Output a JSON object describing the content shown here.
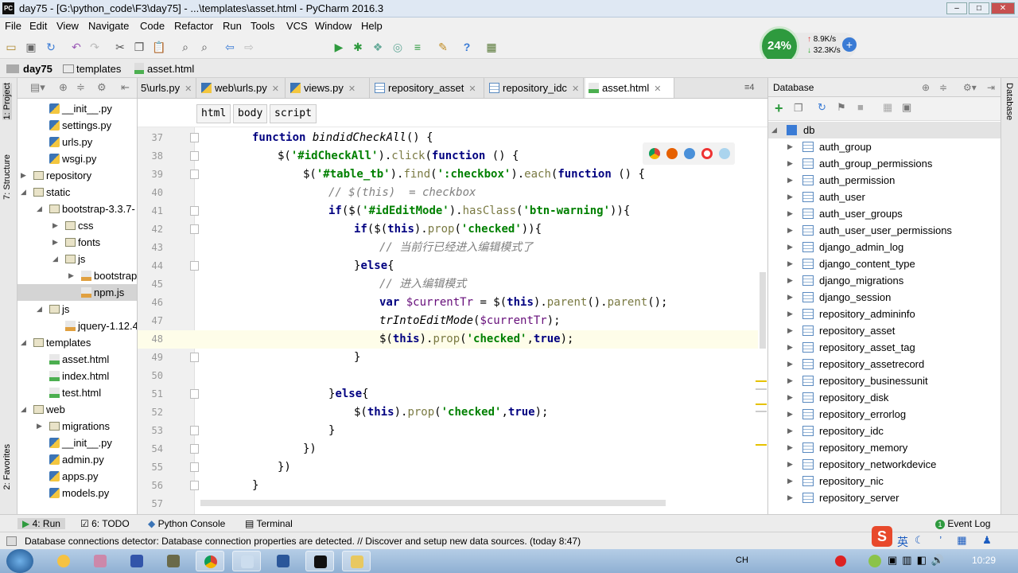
{
  "window": {
    "title": "day75 - [G:\\python_code\\F3\\day75] - ...\\templates\\asset.html - PyCharm 2016.3",
    "logo": "PC"
  },
  "menu": [
    "File",
    "Edit",
    "View",
    "Navigate",
    "Code",
    "Refactor",
    "Run",
    "Tools",
    "VCS",
    "Window",
    "Help"
  ],
  "toolbar": {
    "run_config": "day75",
    "run_config_icon": "dj"
  },
  "net_widget": {
    "cpu": "24%",
    "up": "8.9K/s",
    "down": "32.3K/s"
  },
  "breadcrumb": [
    "day75",
    "templates",
    "asset.html"
  ],
  "left_strip": {
    "project": "1: Project",
    "structure": "7: Structure",
    "favorites": "2: Favorites"
  },
  "project_tree": [
    {
      "label": "__init__.py",
      "depth": 2,
      "icon": "py"
    },
    {
      "label": "settings.py",
      "depth": 2,
      "icon": "py"
    },
    {
      "label": "urls.py",
      "depth": 2,
      "icon": "py"
    },
    {
      "label": "wsgi.py",
      "depth": 2,
      "icon": "py"
    },
    {
      "label": "repository",
      "depth": 1,
      "icon": "folder",
      "arrow": "closed"
    },
    {
      "label": "static",
      "depth": 1,
      "icon": "folder",
      "arrow": "open"
    },
    {
      "label": "bootstrap-3.3.7-",
      "depth": 2,
      "icon": "folder",
      "arrow": "open"
    },
    {
      "label": "css",
      "depth": 3,
      "icon": "folder",
      "arrow": "closed"
    },
    {
      "label": "fonts",
      "depth": 3,
      "icon": "folder",
      "arrow": "closed"
    },
    {
      "label": "js",
      "depth": 3,
      "icon": "folder",
      "arrow": "open"
    },
    {
      "label": "bootstrap",
      "depth": 4,
      "icon": "js",
      "arrow": "closed"
    },
    {
      "label": "npm.js",
      "depth": 4,
      "icon": "js",
      "selected": true
    },
    {
      "label": "js",
      "depth": 2,
      "icon": "folder",
      "arrow": "open"
    },
    {
      "label": "jquery-1.12.4",
      "depth": 3,
      "icon": "js"
    },
    {
      "label": "templates",
      "depth": 1,
      "icon": "folder",
      "arrow": "open"
    },
    {
      "label": "asset.html",
      "depth": 2,
      "icon": "html"
    },
    {
      "label": "index.html",
      "depth": 2,
      "icon": "html"
    },
    {
      "label": "test.html",
      "depth": 2,
      "icon": "html"
    },
    {
      "label": "web",
      "depth": 1,
      "icon": "folder",
      "arrow": "open"
    },
    {
      "label": "migrations",
      "depth": 2,
      "icon": "folder",
      "arrow": "closed"
    },
    {
      "label": "__init__.py",
      "depth": 2,
      "icon": "py"
    },
    {
      "label": "admin.py",
      "depth": 2,
      "icon": "py"
    },
    {
      "label": "apps.py",
      "depth": 2,
      "icon": "py"
    },
    {
      "label": "models.py",
      "depth": 2,
      "icon": "py"
    }
  ],
  "editor_tabs": [
    {
      "label": "5\\urls.py",
      "icon": "py"
    },
    {
      "label": "web\\urls.py",
      "icon": "py"
    },
    {
      "label": "views.py",
      "icon": "py"
    },
    {
      "label": "repository_asset",
      "icon": "tbl"
    },
    {
      "label": "repository_idc",
      "icon": "tbl"
    },
    {
      "label": "asset.html",
      "icon": "html",
      "active": true
    }
  ],
  "tab_overflow": "4",
  "tag_breadcrumb": [
    "html",
    "body",
    "script"
  ],
  "code_lines": [
    {
      "n": "37",
      "indent": 2,
      "fold": true,
      "tokens": [
        [
          "k",
          "function "
        ],
        [
          "fn",
          "bindidCheckAll"
        ],
        [
          "p",
          "() {"
        ]
      ]
    },
    {
      "n": "38",
      "indent": 3,
      "fold": true,
      "tokens": [
        [
          "p",
          "$("
        ],
        [
          "s",
          "'#idCheckAll'"
        ],
        [
          "p",
          ")."
        ],
        [
          "m",
          "click"
        ],
        [
          "p",
          "("
        ],
        [
          "k",
          "function"
        ],
        [
          "p",
          " () {"
        ]
      ]
    },
    {
      "n": "39",
      "indent": 4,
      "fold": true,
      "tokens": [
        [
          "p",
          "$("
        ],
        [
          "s",
          "'#table_tb'"
        ],
        [
          "p",
          ")."
        ],
        [
          "m",
          "find"
        ],
        [
          "p",
          "("
        ],
        [
          "s",
          "':checkbox'"
        ],
        [
          "p",
          ")."
        ],
        [
          "m",
          "each"
        ],
        [
          "p",
          "("
        ],
        [
          "k",
          "function"
        ],
        [
          "p",
          " () {"
        ]
      ]
    },
    {
      "n": "40",
      "indent": 5,
      "tokens": [
        [
          "c",
          "// $(this)  = checkbox"
        ]
      ]
    },
    {
      "n": "41",
      "indent": 5,
      "fold": true,
      "tokens": [
        [
          "k",
          "if"
        ],
        [
          "p",
          "($("
        ],
        [
          "s",
          "'#idEditMode'"
        ],
        [
          "p",
          ")."
        ],
        [
          "m",
          "hasClass"
        ],
        [
          "p",
          "("
        ],
        [
          "s",
          "'btn-warning'"
        ],
        [
          "p",
          ")){"
        ]
      ]
    },
    {
      "n": "42",
      "indent": 6,
      "fold": true,
      "tokens": [
        [
          "k",
          "if"
        ],
        [
          "p",
          "($("
        ],
        [
          "k",
          "this"
        ],
        [
          "p",
          ")."
        ],
        [
          "m",
          "prop"
        ],
        [
          "p",
          "("
        ],
        [
          "s",
          "'checked'"
        ],
        [
          "p",
          ")){"
        ]
      ]
    },
    {
      "n": "43",
      "indent": 7,
      "tokens": [
        [
          "c",
          "// 当前行已经进入编辑模式了"
        ]
      ]
    },
    {
      "n": "44",
      "indent": 6,
      "fold": true,
      "tokens": [
        [
          "p",
          "}"
        ],
        [
          "k",
          "else"
        ],
        [
          "p",
          "{"
        ]
      ]
    },
    {
      "n": "45",
      "indent": 7,
      "tokens": [
        [
          "c",
          "// 进入编辑模式"
        ]
      ]
    },
    {
      "n": "46",
      "indent": 7,
      "tokens": [
        [
          "k",
          "var "
        ],
        [
          "v",
          "$currentTr"
        ],
        [
          "p",
          " = $("
        ],
        [
          "k",
          "this"
        ],
        [
          "p",
          ")."
        ],
        [
          "m",
          "parent"
        ],
        [
          "p",
          "()."
        ],
        [
          "m",
          "parent"
        ],
        [
          "p",
          "();"
        ]
      ]
    },
    {
      "n": "47",
      "indent": 7,
      "tokens": [
        [
          "fn",
          "trIntoEditMode"
        ],
        [
          "p",
          "("
        ],
        [
          "v",
          "$currentTr"
        ],
        [
          "p",
          ");"
        ]
      ]
    },
    {
      "n": "48",
      "indent": 7,
      "current": true,
      "tokens": [
        [
          "p",
          "$("
        ],
        [
          "k",
          "this"
        ],
        [
          "p",
          ")."
        ],
        [
          "m",
          "prop"
        ],
        [
          "p",
          "("
        ],
        [
          "s",
          "'checked'"
        ],
        [
          "p",
          ","
        ],
        [
          "k",
          "true"
        ],
        [
          "p",
          ");"
        ]
      ]
    },
    {
      "n": "49",
      "indent": 6,
      "fold": true,
      "tokens": [
        [
          "p",
          "}"
        ]
      ]
    },
    {
      "n": "50",
      "indent": 0,
      "tokens": []
    },
    {
      "n": "51",
      "indent": 5,
      "fold": true,
      "tokens": [
        [
          "p",
          "}"
        ],
        [
          "k",
          "else"
        ],
        [
          "p",
          "{"
        ]
      ]
    },
    {
      "n": "52",
      "indent": 6,
      "tokens": [
        [
          "p",
          "$("
        ],
        [
          "k",
          "this"
        ],
        [
          "p",
          ")."
        ],
        [
          "m",
          "prop"
        ],
        [
          "p",
          "("
        ],
        [
          "s",
          "'checked'"
        ],
        [
          "p",
          ","
        ],
        [
          "k",
          "true"
        ],
        [
          "p",
          ");"
        ]
      ]
    },
    {
      "n": "53",
      "indent": 5,
      "fold": true,
      "tokens": [
        [
          "p",
          "}"
        ]
      ]
    },
    {
      "n": "54",
      "indent": 4,
      "fold": true,
      "tokens": [
        [
          "p",
          "})"
        ]
      ]
    },
    {
      "n": "55",
      "indent": 3,
      "fold": true,
      "tokens": [
        [
          "p",
          "})"
        ]
      ]
    },
    {
      "n": "56",
      "indent": 2,
      "fold": true,
      "tokens": [
        [
          "p",
          "}"
        ]
      ]
    },
    {
      "n": "57",
      "indent": 0,
      "tokens": []
    }
  ],
  "database": {
    "title": "Database",
    "root": "db",
    "tables": [
      "auth_group",
      "auth_group_permissions",
      "auth_permission",
      "auth_user",
      "auth_user_groups",
      "auth_user_user_permissions",
      "django_admin_log",
      "django_content_type",
      "django_migrations",
      "django_session",
      "repository_admininfo",
      "repository_asset",
      "repository_asset_tag",
      "repository_assetrecord",
      "repository_businessunit",
      "repository_disk",
      "repository_errorlog",
      "repository_idc",
      "repository_memory",
      "repository_networkdevice",
      "repository_nic",
      "repository_server"
    ]
  },
  "right_strip": {
    "database": "Database"
  },
  "bottom_tabs": {
    "run": "4: Run",
    "todo": "6: TODO",
    "console": "Python Console",
    "terminal": "Terminal",
    "event_log": "Event Log",
    "event_count": "1"
  },
  "status": "Database connections detector: Database connection properties are detected. // Discover and setup new data sources. (today 8:47)",
  "taskbar": {
    "clock": "10:29",
    "lang": "CH",
    "ime": "英"
  },
  "colors": {
    "accent": "#2e9a3e",
    "keyword": "#000080",
    "string": "#008000",
    "comment": "#808080"
  }
}
